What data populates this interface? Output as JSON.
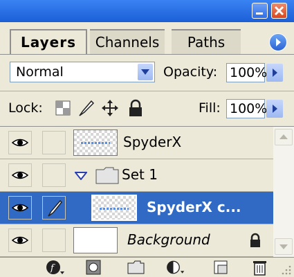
{
  "tabs": {
    "layers": "Layers",
    "channels": "Channels",
    "paths": "Paths"
  },
  "blend": {
    "mode": "Normal",
    "opacity_label": "Opacity:",
    "opacity_value": "100%"
  },
  "lock": {
    "label": "Lock:",
    "fill_label": "Fill:",
    "fill_value": "100%"
  },
  "layers": [
    {
      "name": "SpyderX",
      "type": "layer",
      "visible": true,
      "selected": false
    },
    {
      "name": "Set 1",
      "type": "group",
      "visible": true,
      "expanded": true,
      "selected": false
    },
    {
      "name": "SpyderX c...",
      "type": "layer",
      "visible": true,
      "selected": true,
      "linked_brush": true
    },
    {
      "name": "Background",
      "type": "background",
      "visible": true,
      "locked": true,
      "selected": false
    }
  ],
  "icons": {
    "window_minimize": "minimize-icon",
    "window_close": "close-icon",
    "panel_menu": "panel-menu-icon",
    "lock_transparency": "lock-transparency-icon",
    "lock_image": "lock-image-icon",
    "lock_position": "lock-position-icon",
    "lock_all": "lock-all-icon",
    "layer_style": "layer-style-icon",
    "add_mask": "add-mask-icon",
    "new_set": "new-set-icon",
    "new_adjustment": "new-adjustment-icon",
    "new_layer": "new-layer-icon",
    "delete_layer": "trash-icon"
  },
  "colors": {
    "titlebar": "#1b5fd6",
    "selection": "#316ac5",
    "panel_bg": "#ece9d8"
  }
}
